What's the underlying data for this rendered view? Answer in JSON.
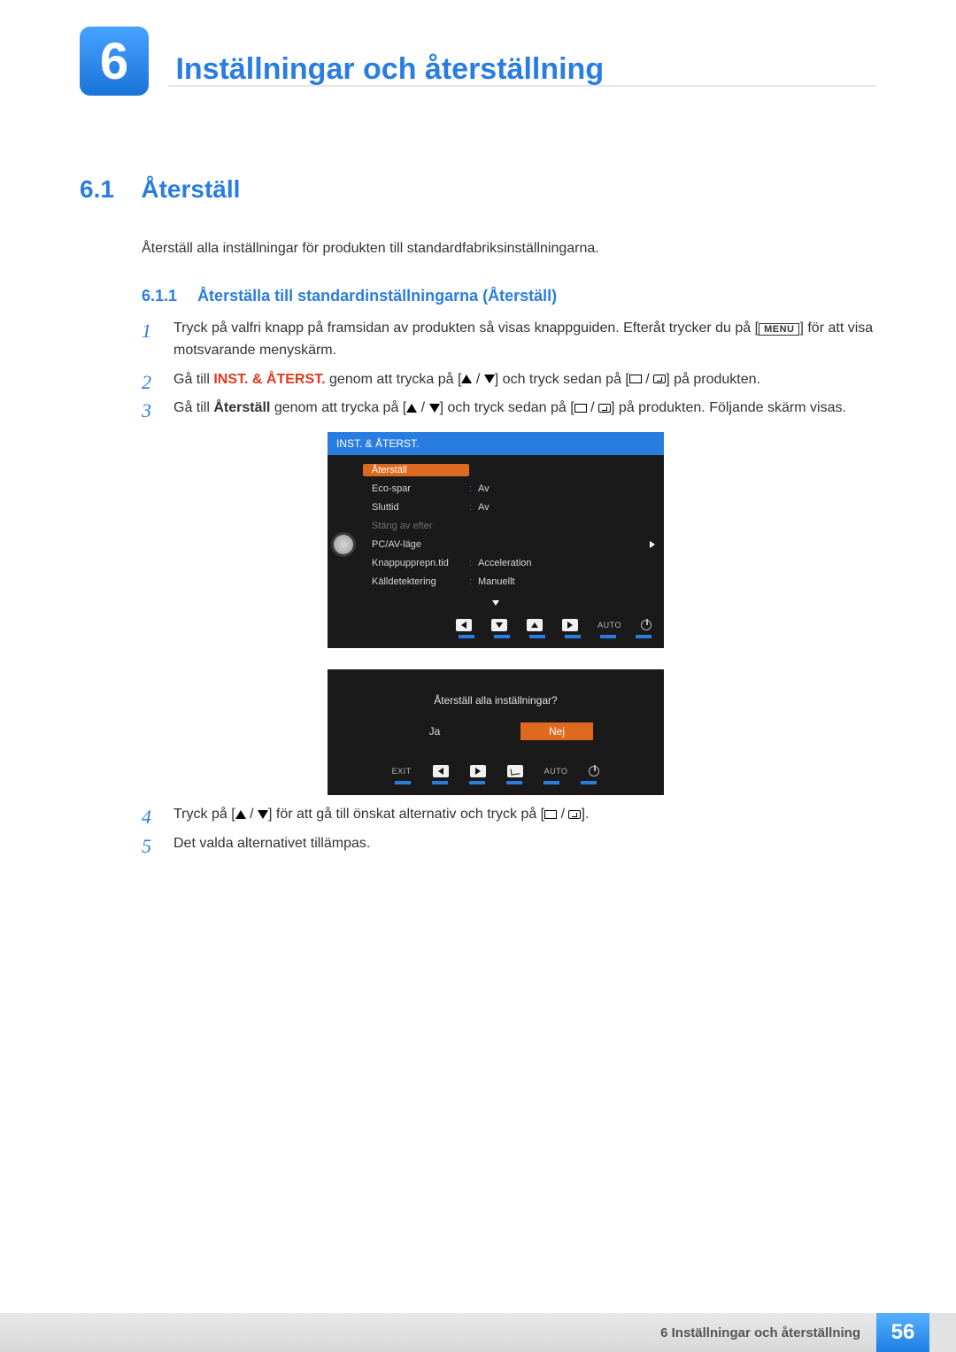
{
  "chapter": {
    "number": "6",
    "title": "Inställningar och återställning"
  },
  "section": {
    "number": "6.1",
    "title": "Återställ",
    "description": "Återställ alla inställningar för produkten till standardfabriksinställningarna."
  },
  "subsection": {
    "number": "6.1.1",
    "title": "Återställa till standardinställningarna (Återställ)"
  },
  "steps": {
    "s1a": "Tryck på valfri knapp på framsidan av produkten så visas knappguiden. Efteråt trycker du på [",
    "s1_menu": "MENU",
    "s1b": "] för att visa motsvarande menyskärm.",
    "s2a": "Gå till ",
    "s2_bold": "INST. & ÅTERST.",
    "s2b": " genom att trycka på [",
    "s2c": "] och tryck sedan på [",
    "s2d": "] på produkten.",
    "s3a": "Gå till ",
    "s3_bold": "Återställ",
    "s3b": " genom att trycka på [",
    "s3c": "] och tryck sedan på [",
    "s3d": "] på produkten. Följande skärm visas.",
    "s4a": "Tryck på [",
    "s4b": "] för att gå till önskat alternativ och tryck på [",
    "s4c": "].",
    "s5": "Det valda alternativet tillämpas."
  },
  "osd": {
    "title": "INST. & ÅTERST.",
    "rows": [
      {
        "label": "Återställ",
        "value": "",
        "selected": true
      },
      {
        "label": "Eco-spar",
        "value": "Av"
      },
      {
        "label": "Sluttid",
        "value": "Av"
      },
      {
        "label": "Stäng av efter",
        "value": "",
        "dim": true
      },
      {
        "label": "PC/AV-läge",
        "value": "",
        "arrow": true
      },
      {
        "label": "Knappupprepn.tid",
        "value": "Acceleration"
      },
      {
        "label": "Källdetektering",
        "value": "Manuellt"
      }
    ],
    "footer_auto": "AUTO"
  },
  "confirm": {
    "question": "Återställ alla inställningar?",
    "yes": "Ja",
    "no": "Nej",
    "exit": "EXIT",
    "auto": "AUTO"
  },
  "footer": {
    "text": "6 Inställningar och återställning",
    "page": "56"
  }
}
